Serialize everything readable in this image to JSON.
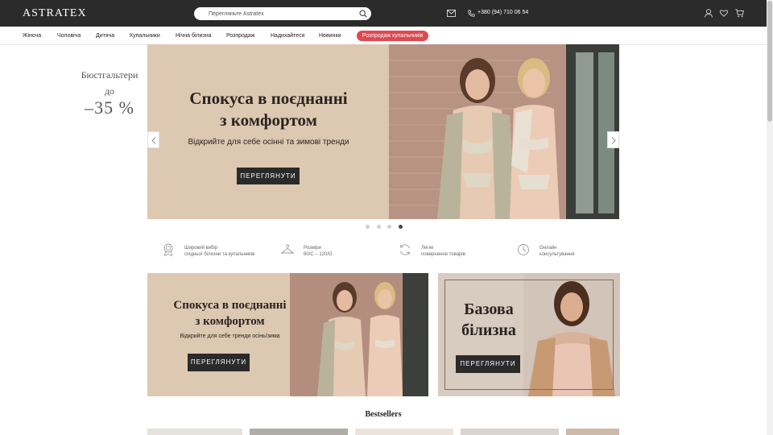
{
  "header": {
    "logo": "ASTRATEX",
    "search_placeholder": "Перегляньте Astratex",
    "phone": "+380 (94) 710 06 54",
    "icons": [
      "search-icon",
      "mail-icon",
      "phone-icon",
      "user-icon",
      "heart-icon",
      "cart-icon"
    ]
  },
  "nav": {
    "items": [
      {
        "label": "Жіноча"
      },
      {
        "label": "Чоловіча"
      },
      {
        "label": "Дитяча"
      },
      {
        "label": "Купальники"
      },
      {
        "label": "Нічна білизна"
      },
      {
        "label": "Розпродаж"
      },
      {
        "label": "Надихайтеся"
      },
      {
        "label": "Новинки"
      }
    ],
    "promo": "Розпродаж купальників"
  },
  "side_promo": {
    "line1": "Бюстгальтери",
    "line2": "до",
    "line3": "–35 %"
  },
  "hero": {
    "title_line1": "Спокуса в поєднанні",
    "title_line2": "з комфортом",
    "subtitle": "Відкрийте для себе осінні та зимові тренди",
    "button": "ПЕРЕГЛЯНУТИ",
    "slides_total": 4,
    "active_slide": 4
  },
  "features": [
    {
      "icon": "award-icon",
      "line1": "Широкий вибір",
      "line2": "спідньої білизни та купальників"
    },
    {
      "icon": "hanger-icon",
      "line1": "Розміри",
      "line2": "60/C – 120/G"
    },
    {
      "icon": "return-icon",
      "line1": "Легке",
      "line2": "повернення товарів"
    },
    {
      "icon": "clock-icon",
      "line1": "Онлайн",
      "line2": "консультування"
    }
  ],
  "banner_left": {
    "title_line1": "Спокуса в поєднанні",
    "title_line2": "з комфортом",
    "subtitle": "Відкрийте для себе тренди осінь/зима",
    "button": "ПЕРЕГЛЯНУТИ"
  },
  "banner_right": {
    "title_line1": "Базова",
    "title_line2": "білизна",
    "button": "ПЕРЕГЛЯНУТИ"
  },
  "bestsellers": {
    "title": "Bestsellers"
  }
}
